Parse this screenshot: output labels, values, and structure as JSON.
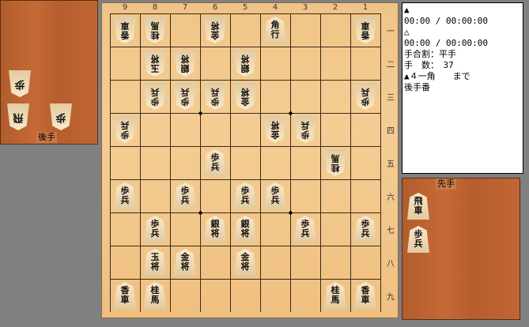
{
  "info": {
    "lines": [
      "▲",
      "00:00 / 00:00:00",
      "△",
      "00:00 / 00:00:00",
      "手合割：平手",
      "手　数：　37",
      "▲４一角　　まで",
      "後手番"
    ]
  },
  "stands": {
    "gote_label": "後手",
    "sente_label": "先手",
    "gote_pieces": [
      "歩",
      "飛",
      "歩"
    ],
    "sente_pieces": [
      "飛車",
      "歩兵"
    ]
  },
  "board": {
    "file_labels": [
      "9",
      "8",
      "7",
      "6",
      "5",
      "4",
      "3",
      "2",
      "1"
    ],
    "rank_labels": [
      "一",
      "二",
      "三",
      "四",
      "五",
      "六",
      "七",
      "八",
      "九"
    ],
    "pieces": [
      {
        "file": 9,
        "rank": 1,
        "text": "香車",
        "side": "gote"
      },
      {
        "file": 8,
        "rank": 1,
        "text": "桂馬",
        "side": "gote"
      },
      {
        "file": 6,
        "rank": 1,
        "text": "金将",
        "side": "gote"
      },
      {
        "file": 4,
        "rank": 1,
        "text": "角行",
        "side": "sente"
      },
      {
        "file": 1,
        "rank": 1,
        "text": "香車",
        "side": "gote"
      },
      {
        "file": 8,
        "rank": 2,
        "text": "玉将",
        "side": "gote"
      },
      {
        "file": 7,
        "rank": 2,
        "text": "銀将",
        "side": "gote"
      },
      {
        "file": 5,
        "rank": 2,
        "text": "銀将",
        "side": "gote"
      },
      {
        "file": 8,
        "rank": 3,
        "text": "歩兵",
        "side": "gote"
      },
      {
        "file": 7,
        "rank": 3,
        "text": "歩兵",
        "side": "gote"
      },
      {
        "file": 6,
        "rank": 3,
        "text": "歩兵",
        "side": "gote"
      },
      {
        "file": 5,
        "rank": 3,
        "text": "金将",
        "side": "gote"
      },
      {
        "file": 1,
        "rank": 3,
        "text": "歩兵",
        "side": "gote"
      },
      {
        "file": 9,
        "rank": 4,
        "text": "歩兵",
        "side": "gote"
      },
      {
        "file": 4,
        "rank": 4,
        "text": "金将",
        "side": "gote"
      },
      {
        "file": 3,
        "rank": 4,
        "text": "歩兵",
        "side": "gote"
      },
      {
        "file": 6,
        "rank": 5,
        "text": "歩兵",
        "side": "sente"
      },
      {
        "file": 2,
        "rank": 5,
        "text": "桂馬",
        "side": "gote"
      },
      {
        "file": 9,
        "rank": 6,
        "text": "歩兵",
        "side": "sente"
      },
      {
        "file": 7,
        "rank": 6,
        "text": "歩兵",
        "side": "sente"
      },
      {
        "file": 5,
        "rank": 6,
        "text": "歩兵",
        "side": "sente"
      },
      {
        "file": 4,
        "rank": 6,
        "text": "歩兵",
        "side": "sente"
      },
      {
        "file": 8,
        "rank": 7,
        "text": "歩兵",
        "side": "sente"
      },
      {
        "file": 6,
        "rank": 7,
        "text": "銀将",
        "side": "sente"
      },
      {
        "file": 5,
        "rank": 7,
        "text": "銀将",
        "side": "sente"
      },
      {
        "file": 3,
        "rank": 7,
        "text": "歩兵",
        "side": "sente"
      },
      {
        "file": 1,
        "rank": 7,
        "text": "歩兵",
        "side": "sente"
      },
      {
        "file": 8,
        "rank": 8,
        "text": "玉将",
        "side": "sente"
      },
      {
        "file": 7,
        "rank": 8,
        "text": "金将",
        "side": "sente"
      },
      {
        "file": 5,
        "rank": 8,
        "text": "金将",
        "side": "sente"
      },
      {
        "file": 9,
        "rank": 9,
        "text": "香車",
        "side": "sente"
      },
      {
        "file": 8,
        "rank": 9,
        "text": "桂馬",
        "side": "sente"
      },
      {
        "file": 2,
        "rank": 9,
        "text": "桂馬",
        "side": "sente"
      },
      {
        "file": 1,
        "rank": 9,
        "text": "香車",
        "side": "sente"
      }
    ]
  }
}
